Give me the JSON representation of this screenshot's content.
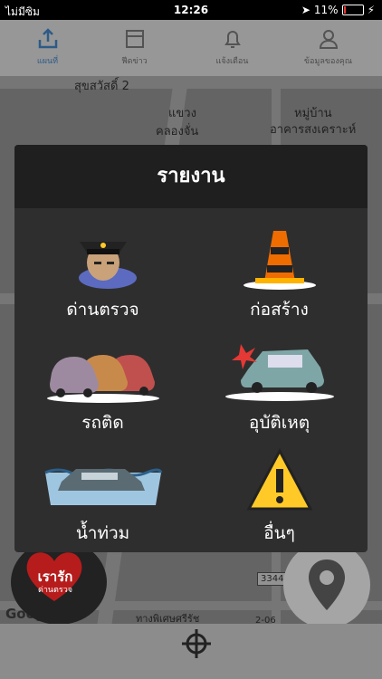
{
  "status_bar": {
    "carrier": "ไม่มีซิม",
    "time": "12:26",
    "battery_percent": "11%",
    "battery_level": 0.11
  },
  "tabs": [
    {
      "label": "แผนที่",
      "icon": "share-upload-icon",
      "active": true
    },
    {
      "label": "ฟีดข่าว",
      "icon": "news-feed-icon",
      "active": false
    },
    {
      "label": "แจ้งเตือน",
      "icon": "bell-icon",
      "active": false
    },
    {
      "label": "ข้อมูลของคุณ",
      "icon": "user-icon",
      "active": false
    }
  ],
  "map": {
    "labels": [
      "สุขสวัสดิ์ 2",
      "แขวง",
      "คลองจั่น",
      "หมู่บ้าน",
      "อาคารสงเคราะห์",
      "ทางพิเศษศรีรัช",
      "3344",
      "2-06"
    ]
  },
  "logo": {
    "line1": "เรารัก",
    "line2": "ด่านตรวจ"
  },
  "google": "Google",
  "modal": {
    "title": "รายงาน",
    "items": [
      {
        "label": "ด่านตรวจ",
        "icon": "police-officer-icon"
      },
      {
        "label": "ก่อสร้าง",
        "icon": "traffic-cone-icon"
      },
      {
        "label": "รถติด",
        "icon": "traffic-jam-icon"
      },
      {
        "label": "อุบัติเหตุ",
        "icon": "car-crash-icon"
      },
      {
        "label": "น้ำท่วม",
        "icon": "flood-car-icon"
      },
      {
        "label": "อื่นๆ",
        "icon": "warning-sign-icon"
      }
    ]
  },
  "colors": {
    "accent": "#1976d2",
    "modal_bg": "#2e2e2e",
    "modal_header": "#1f1f1f"
  }
}
